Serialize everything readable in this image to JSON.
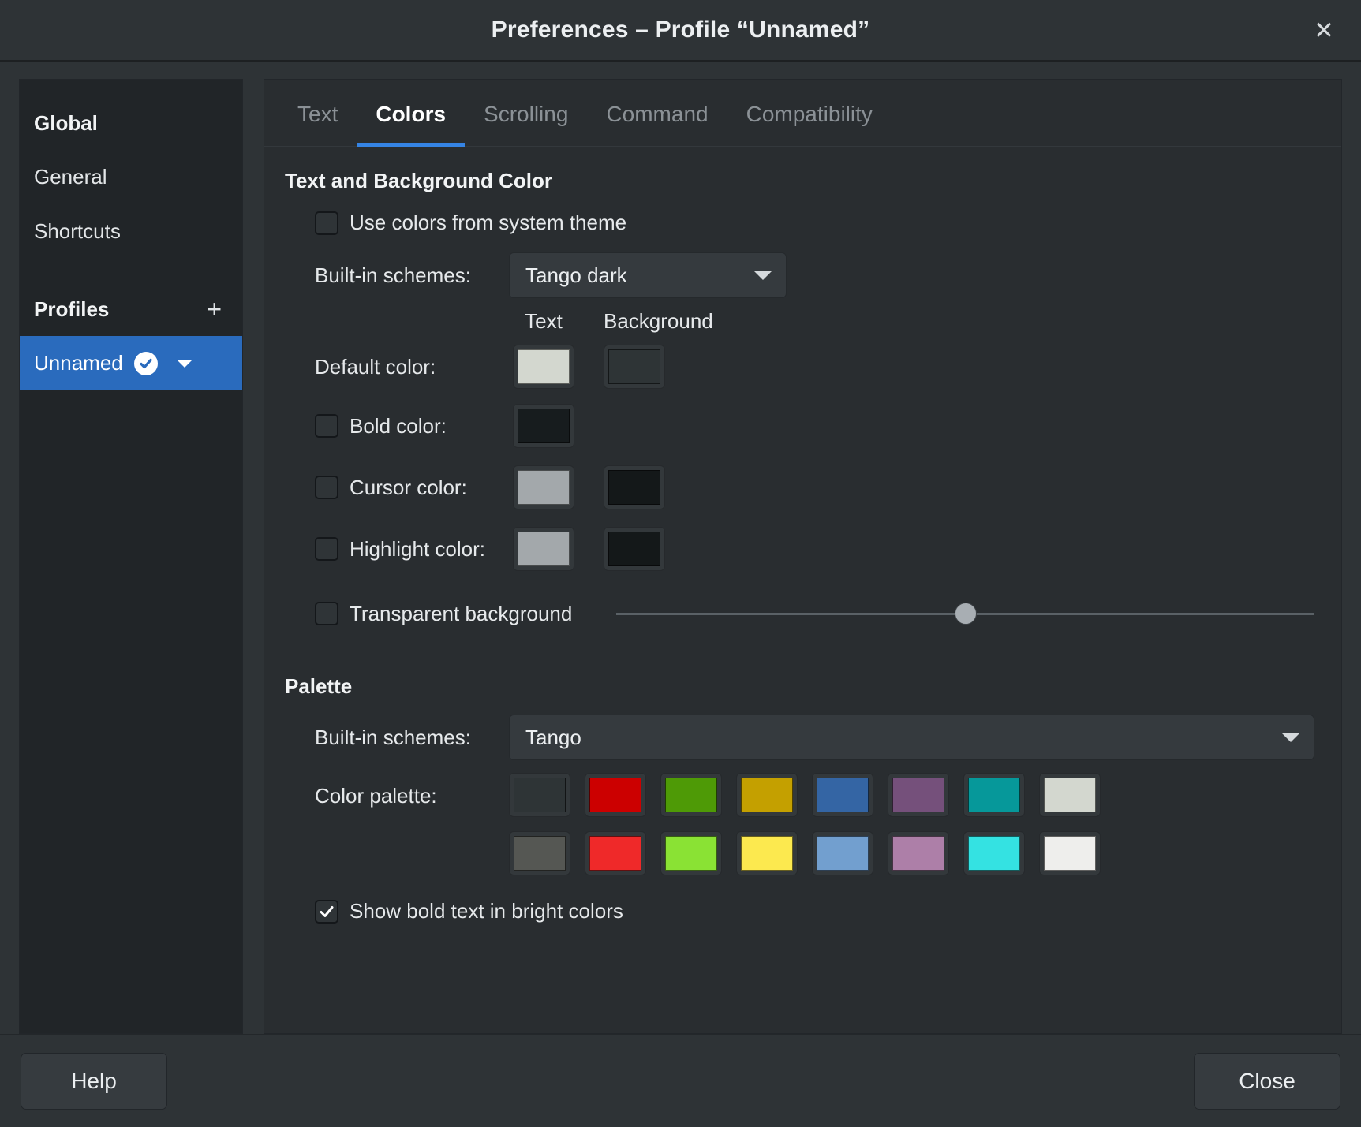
{
  "window": {
    "title": "Preferences – Profile “Unnamed”",
    "close_icon": "close-icon"
  },
  "sidebar": {
    "global_header": "Global",
    "items": [
      {
        "label": "General"
      },
      {
        "label": "Shortcuts"
      }
    ],
    "profiles_header": "Profiles",
    "add_profile_label": "+",
    "profiles": [
      {
        "label": "Unnamed",
        "selected": true,
        "badge_icon": "check-circle-icon",
        "menu_icon": "chevron-down-icon"
      }
    ]
  },
  "tabs": [
    {
      "label": "Text",
      "active": false
    },
    {
      "label": "Colors",
      "active": true
    },
    {
      "label": "Scrolling",
      "active": false
    },
    {
      "label": "Command",
      "active": false
    },
    {
      "label": "Compatibility",
      "active": false
    }
  ],
  "colors_tab": {
    "text_bg_section": {
      "title": "Text and Background Color",
      "use_system_theme": {
        "label": "Use colors from system theme",
        "checked": false
      },
      "builtin_schemes": {
        "label": "Built-in schemes:",
        "value": "Tango dark"
      },
      "column_headers": {
        "text": "Text",
        "background": "Background"
      },
      "rows": [
        {
          "label": "Default color:",
          "has_checkbox": false,
          "checked": false,
          "text_color": "#d3d7cf",
          "background_color": "#2e3436",
          "has_background": true
        },
        {
          "label": "Bold color:",
          "has_checkbox": true,
          "checked": false,
          "text_color": "#171c1e",
          "has_background": false
        },
        {
          "label": "Cursor color:",
          "has_checkbox": true,
          "checked": false,
          "text_color": "#a3a8ab",
          "background_color": "#141819",
          "has_background": true
        },
        {
          "label": "Highlight color:",
          "has_checkbox": true,
          "checked": false,
          "text_color": "#a3a8ab",
          "background_color": "#141819",
          "has_background": true
        }
      ],
      "transparent_background": {
        "label": "Transparent background",
        "checked": false
      },
      "transparency_slider": {
        "value_percent": 50
      }
    },
    "palette_section": {
      "title": "Palette",
      "builtin_schemes": {
        "label": "Built-in schemes:",
        "value": "Tango"
      },
      "color_palette_label": "Color palette:",
      "palette_rows": [
        [
          "#2e3436",
          "#cc0000",
          "#4e9a06",
          "#c4a000",
          "#3465a4",
          "#75507b",
          "#06989a",
          "#d3d7cf"
        ],
        [
          "#555753",
          "#ef2929",
          "#8ae234",
          "#fce94f",
          "#729fcf",
          "#ad7fa8",
          "#34e2e2",
          "#eeeeec"
        ]
      ],
      "show_bold_bright": {
        "label": "Show bold text in bright colors",
        "checked": true
      }
    }
  },
  "footer": {
    "help_label": "Help",
    "close_label": "Close"
  },
  "theme": {
    "accent": "#3584e4",
    "selection": "#2a6bbd",
    "window_bg": "#2e3336",
    "sidebar_bg": "#212528",
    "content_bg": "#292d30"
  }
}
